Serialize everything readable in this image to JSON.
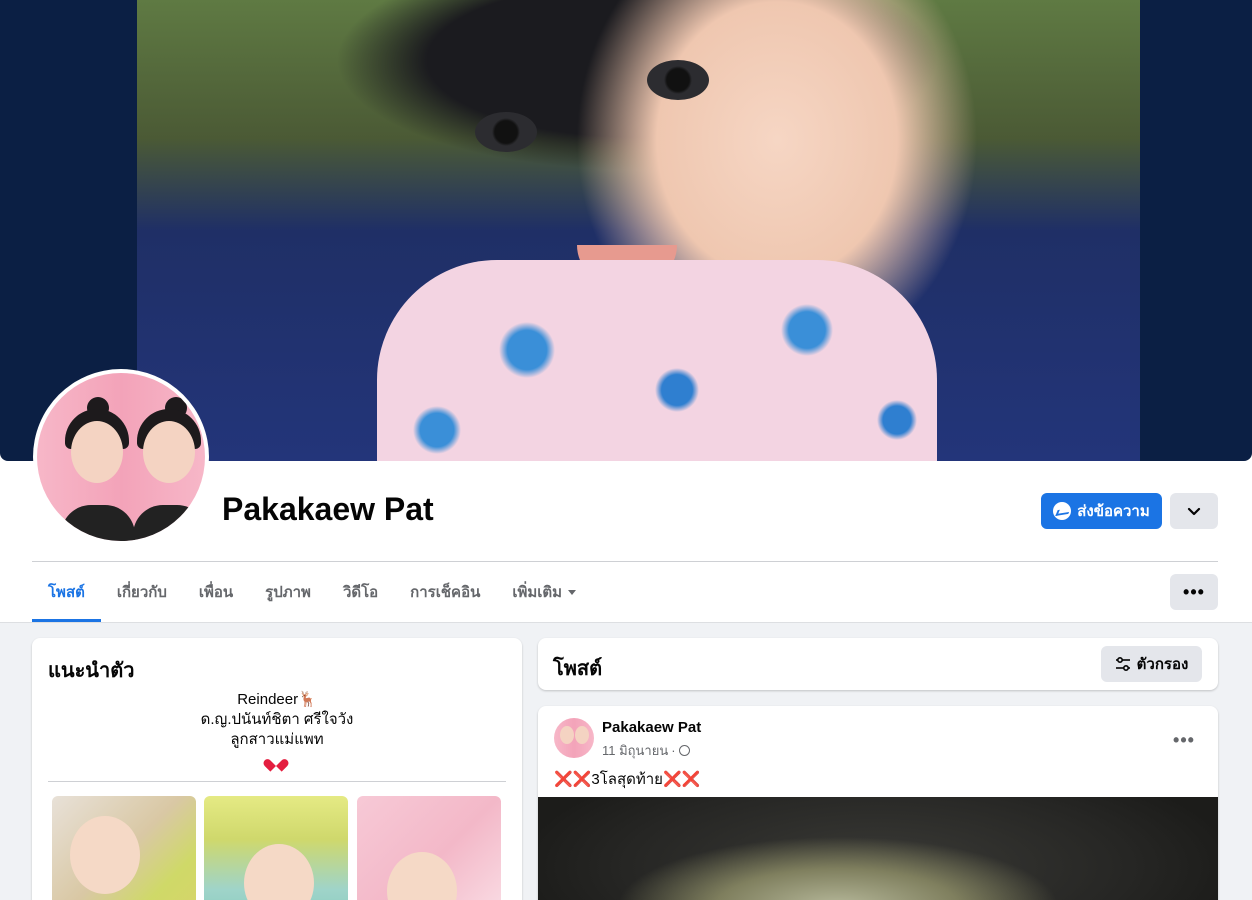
{
  "profile": {
    "name": "Pakakaew Pat",
    "message_label": "ส่งข้อความ"
  },
  "tabs": [
    {
      "label": "โพสต์",
      "active": true
    },
    {
      "label": "เกี่ยวกับ",
      "active": false
    },
    {
      "label": "เพื่อน",
      "active": false
    },
    {
      "label": "รูปภาพ",
      "active": false
    },
    {
      "label": "วิดีโอ",
      "active": false
    },
    {
      "label": "การเช็คอิน",
      "active": false
    },
    {
      "label": "เพิ่มเติม",
      "active": false
    }
  ],
  "more_label": "•••",
  "intro": {
    "title": "แนะนำตัว",
    "bio_lines": [
      "Reindeer🦌",
      "ด.ญ.ปนันท์ชิตา ศรีใจวัง",
      "ลูกสาวแม่แพท"
    ]
  },
  "posts": {
    "title": "โพสต์",
    "filter_label": "ตัวกรอง"
  },
  "post": {
    "author": "Pakakaew Pat",
    "date": "11 มิถุนายน",
    "separator": "·",
    "text": "❌❌3โลสุดท้าย❌❌",
    "more_label": "•••"
  },
  "colors": {
    "accent": "#1b74e4",
    "page_bg": "#f0f2f5",
    "secondary_button": "#e4e6eb",
    "secondary_text": "#65676b"
  }
}
